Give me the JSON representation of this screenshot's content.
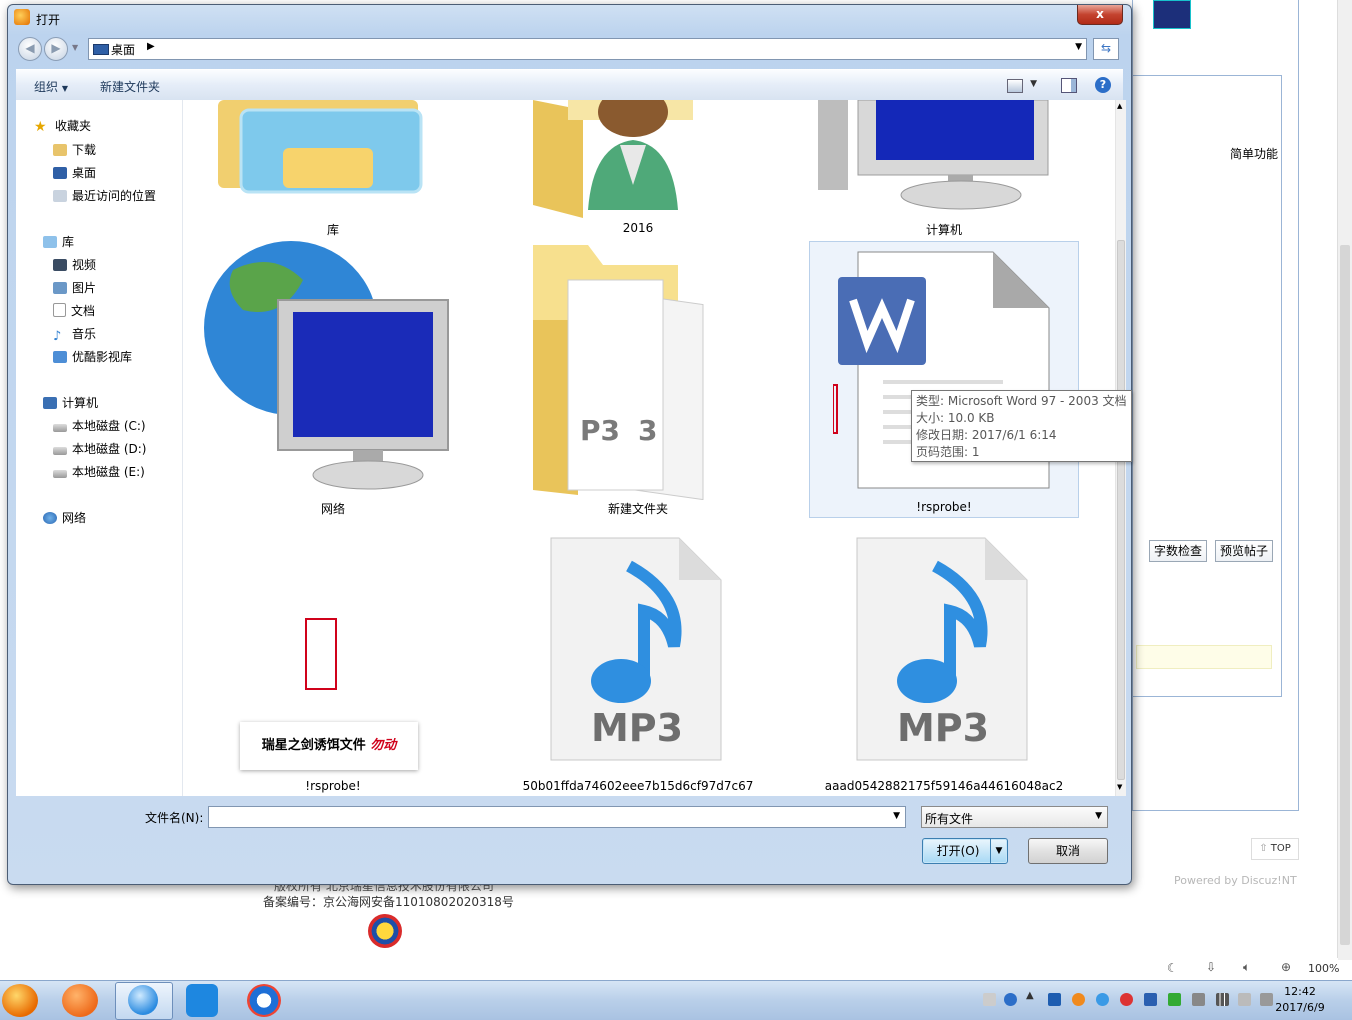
{
  "background": {
    "simple_function": "简单功能",
    "word_count_button": "字数检查",
    "preview_button": "预览帖子",
    "top_link": "TOP",
    "powered_by": "Powered by Discuz!NT",
    "footer_line1": "版权所有 北京瑞星信息技术股份有限公司",
    "footer_line2": "备案编号：京公海网安备11010802020318号",
    "zoom": "100%"
  },
  "dialog": {
    "title": "打开",
    "close": "x",
    "address": {
      "location": "桌面"
    },
    "toolbar": {
      "organize": "组织",
      "new_folder": "新建文件夹",
      "help": "?"
    },
    "sidebar": {
      "groups": [
        {
          "label": "收藏夹",
          "icon": "star-icon",
          "items": [
            {
              "label": "下载",
              "icon": "download-folder-icon"
            },
            {
              "label": "桌面",
              "icon": "desktop-icon"
            },
            {
              "label": "最近访问的位置",
              "icon": "recent-places-icon"
            }
          ]
        },
        {
          "label": "库",
          "icon": "library-icon",
          "items": [
            {
              "label": "视频",
              "icon": "video-icon"
            },
            {
              "label": "图片",
              "icon": "picture-icon"
            },
            {
              "label": "文档",
              "icon": "document-icon"
            },
            {
              "label": "音乐",
              "icon": "music-icon"
            },
            {
              "label": "优酷影视库",
              "icon": "youku-library-icon"
            }
          ]
        },
        {
          "label": "计算机",
          "icon": "computer-icon",
          "items": [
            {
              "label": "本地磁盘 (C:)",
              "icon": "disk-c-icon"
            },
            {
              "label": "本地磁盘 (D:)",
              "icon": "disk-d-icon"
            },
            {
              "label": "本地磁盘 (E:)",
              "icon": "disk-e-icon"
            }
          ]
        },
        {
          "label": "网络",
          "icon": "network-icon",
          "items": []
        }
      ]
    },
    "files": [
      {
        "label": "库",
        "icon": "library-folder-icon"
      },
      {
        "label": "2016",
        "icon": "user-folder-icon"
      },
      {
        "label": "计算机",
        "icon": "computer-monitor-icon"
      },
      {
        "label": "网络",
        "icon": "network-globe-icon"
      },
      {
        "label": "新建文件夹",
        "icon": "folder-icon"
      },
      {
        "label": "!rsprobe!",
        "icon": "word-document-icon",
        "selected": true
      },
      {
        "label": "!rsprobe!",
        "icon": "rising-bait-file-icon",
        "bait_text": "瑞星之剑诱饵文件",
        "bait_tag": "勿动"
      },
      {
        "label": "50b01ffda74602eee7b15d6cf97d7c67",
        "icon": "mp3-icon",
        "mp3_text": "MP3"
      },
      {
        "label": "aaad0542882175f59146a44616048ac2",
        "icon": "mp3-icon",
        "mp3_text": "MP3"
      }
    ],
    "tooltip": {
      "type": "类型: Microsoft Word 97 - 2003 文档",
      "size": "大小: 10.0 KB",
      "modified": "修改日期: 2017/6/1 6:14",
      "pages": "页码范围: 1"
    },
    "filename_label": "文件名(N):",
    "filename_value": "",
    "filetype": "所有文件",
    "open_button": "打开(O)",
    "cancel_button": "取消"
  },
  "taskbar": {
    "time": "12:42",
    "date": "2017/6/9",
    "apps": [
      "rising-antivirus-icon",
      "xiami-icon",
      "qq-browser-icon",
      "tencent-assistant-icon",
      "video-player-icon"
    ]
  },
  "colors": {
    "accent": "#3c7fb1",
    "bait_red": "#d0021b",
    "word_blue": "#4a6db5",
    "mp3_blue": "#2f8fe0"
  }
}
